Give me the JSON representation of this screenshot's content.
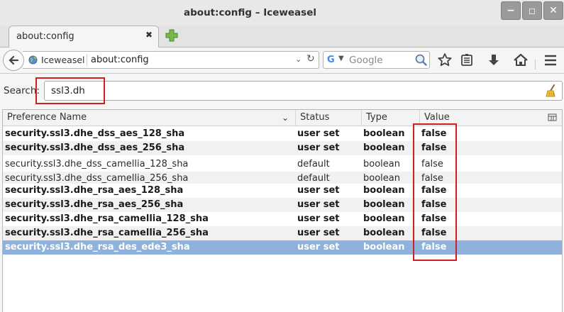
{
  "window": {
    "title": "about:config – Iceweasel",
    "controls": [
      "minimize",
      "maximize",
      "close"
    ]
  },
  "tabs": [
    {
      "label": "about:config",
      "close_glyph": "✖"
    }
  ],
  "navbar": {
    "identity_label": "Iceweasel",
    "url": "about:config",
    "search_engine": "G",
    "search_placeholder": "Google",
    "icons": [
      "back-icon",
      "globe-icon",
      "reload-icon",
      "search-icon",
      "star-icon",
      "reading-list-icon",
      "download-icon",
      "home-icon",
      "menu-icon"
    ]
  },
  "config": {
    "search_label": "Search:",
    "search_value": "ssl3.dh",
    "columns": [
      "Preference Name",
      "Status",
      "Type",
      "Value"
    ],
    "rows": [
      {
        "name": "security.ssl3.dhe_dss_aes_128_sha",
        "status": "user set",
        "type": "boolean",
        "value": "false"
      },
      {
        "name": "security.ssl3.dhe_dss_aes_256_sha",
        "status": "user set",
        "type": "boolean",
        "value": "false"
      },
      {
        "name": "security.ssl3.dhe_dss_camellia_128_sha",
        "status": "default",
        "type": "boolean",
        "value": "false"
      },
      {
        "name": "security.ssl3.dhe_dss_camellia_256_sha",
        "status": "default",
        "type": "boolean",
        "value": "false"
      },
      {
        "name": "security.ssl3.dhe_rsa_aes_128_sha",
        "status": "user set",
        "type": "boolean",
        "value": "false"
      },
      {
        "name": "security.ssl3.dhe_rsa_aes_256_sha",
        "status": "user set",
        "type": "boolean",
        "value": "false"
      },
      {
        "name": "security.ssl3.dhe_rsa_camellia_128_sha",
        "status": "user set",
        "type": "boolean",
        "value": "false"
      },
      {
        "name": "security.ssl3.dhe_rsa_camellia_256_sha",
        "status": "user set",
        "type": "boolean",
        "value": "false"
      },
      {
        "name": "security.ssl3.dhe_rsa_des_ede3_sha",
        "status": "user set",
        "type": "boolean",
        "value": "false"
      }
    ],
    "selected_row": 8,
    "highlight_color": "#d21e1e",
    "selection_color": "#8fb2dd"
  }
}
